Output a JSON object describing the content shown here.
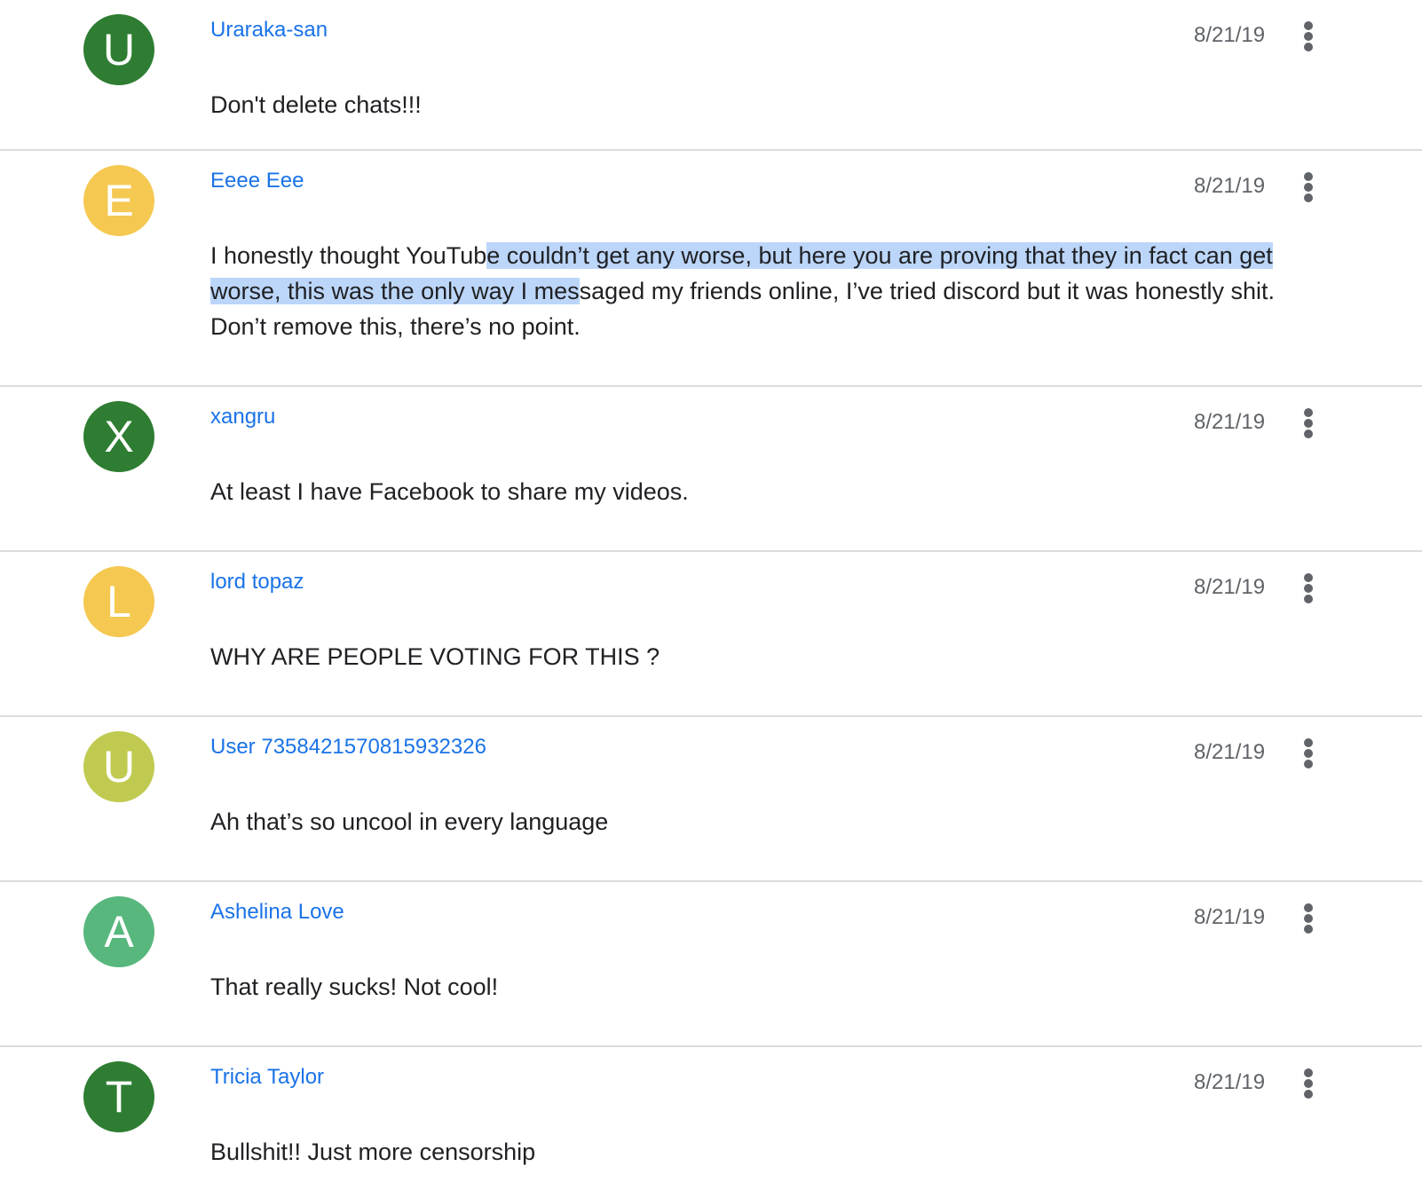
{
  "colors": {
    "author_link": "#1a73e8",
    "date_text": "#5f6368",
    "body_text": "#202124",
    "divider": "#dcdcdc",
    "selection_highlight": "#bcd6f9",
    "avatar_dark_green": "#2e7d32",
    "avatar_yellow": "#f5c851",
    "avatar_lime": "#c0ca50",
    "avatar_light_green": "#57b77d"
  },
  "comments": [
    {
      "initial": "U",
      "avatar_color": "#2e7d32",
      "author": "Uraraka-san",
      "date": "8/21/19",
      "text": "Don't delete chats!!!",
      "more_icon": "more-vert-icon"
    },
    {
      "initial": "E",
      "avatar_color": "#f5c851",
      "author": "Eeee Eee",
      "date": "8/21/19",
      "text_parts": {
        "before": "I honestly thought YouTub",
        "selected_line1": "e couldn’t get any worse, but here you are proving that they in fact can get",
        "selected_line2": "worse, this was the only way I mes",
        "after": "saged my friends online, I’ve tried discord but it was honestly shit. Don’t remove this, there’s no point."
      },
      "more_icon": "more-vert-icon"
    },
    {
      "initial": "X",
      "avatar_color": "#2e7d32",
      "author": "xangru",
      "date": "8/21/19",
      "text": "At least I have Facebook to share my videos.",
      "more_icon": "more-vert-icon"
    },
    {
      "initial": "L",
      "avatar_color": "#f5c851",
      "author": "lord topaz",
      "date": "8/21/19",
      "text": "WHY ARE PEOPLE VOTING FOR THIS ?",
      "more_icon": "more-vert-icon"
    },
    {
      "initial": "U",
      "avatar_color": "#c0ca50",
      "author": "User 7358421570815932326",
      "date": "8/21/19",
      "text": "Ah that’s so uncool in every language",
      "more_icon": "more-vert-icon"
    },
    {
      "initial": "A",
      "avatar_color": "#57b77d",
      "author": "Ashelina Love",
      "date": "8/21/19",
      "text": "That really sucks! Not cool!",
      "more_icon": "more-vert-icon"
    },
    {
      "initial": "T",
      "avatar_color": "#2e7d32",
      "author": "Tricia Taylor",
      "date": "8/21/19",
      "text": "Bullshit!! Just more censorship",
      "more_icon": "more-vert-icon"
    }
  ]
}
